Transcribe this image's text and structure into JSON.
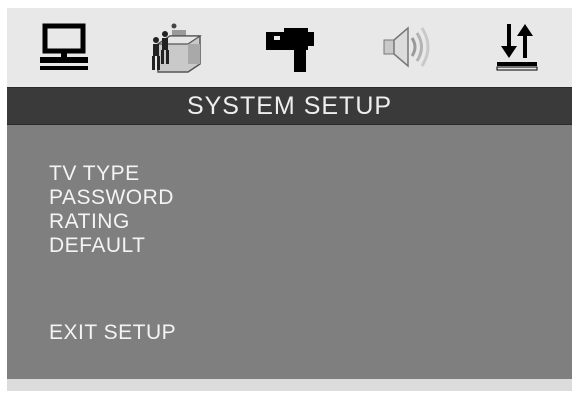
{
  "icons": [
    {
      "name": "system-setup-icon",
      "selected": true
    },
    {
      "name": "language-setup-icon",
      "selected": false
    },
    {
      "name": "video-setup-icon",
      "selected": false
    },
    {
      "name": "audio-setup-icon",
      "selected": false
    },
    {
      "name": "misc-setup-icon",
      "selected": false
    }
  ],
  "title": "SYSTEM SETUP",
  "menu": {
    "items": [
      "TV TYPE",
      "PASSWORD",
      "RATING",
      "DEFAULT"
    ],
    "exit": "EXIT SETUP"
  },
  "colors": {
    "icon_bar_bg": "#e8e8e8",
    "title_bar_bg": "#3a3a3a",
    "title_text": "#eeeeee",
    "menu_bg": "#7f7f7f",
    "menu_text": "#f4f4f4"
  }
}
